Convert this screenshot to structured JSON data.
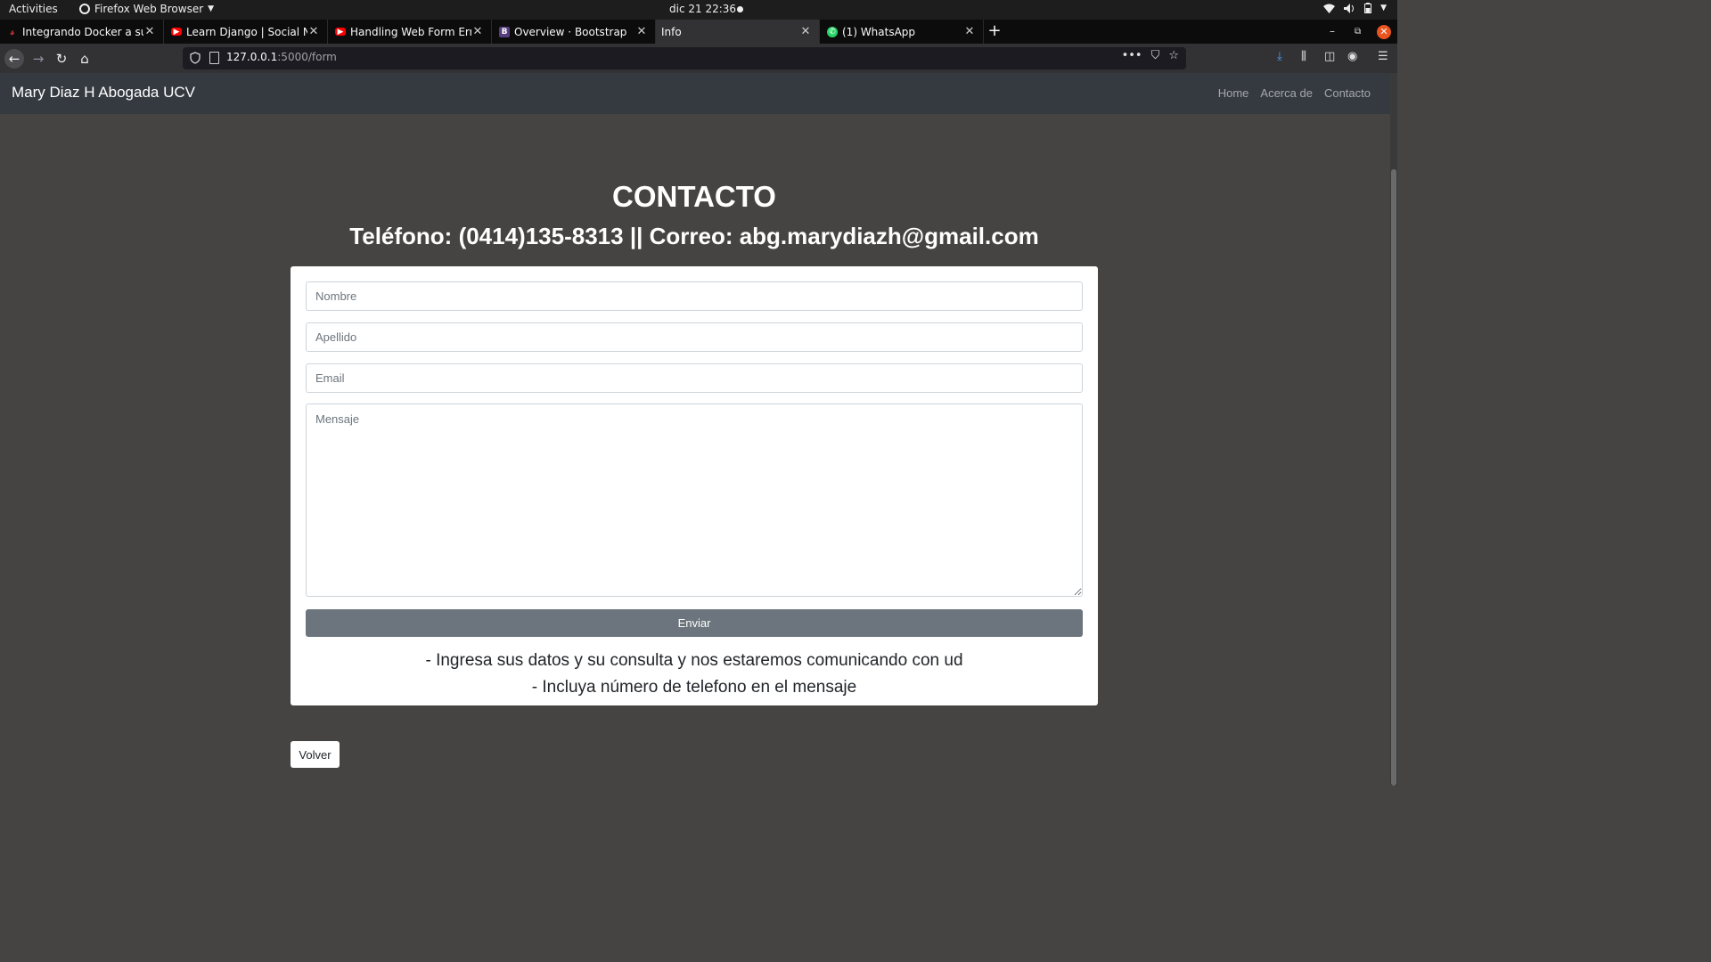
{
  "os_bar": {
    "activities": "Activities",
    "app_name": "Firefox Web Browser",
    "clock": "dic 21  22:36"
  },
  "browser": {
    "tabs": [
      {
        "title": "Integrando Docker a su",
        "favicon": "red-logo-icon",
        "color": "#d7333a",
        "active": false
      },
      {
        "title": "Learn Django | Social Ne",
        "favicon": "youtube-icon",
        "color": "#ff0000",
        "active": false
      },
      {
        "title": "Handling Web Form Erro",
        "favicon": "youtube-icon",
        "color": "#ff0000",
        "active": false
      },
      {
        "title": "Overview · Bootstrap",
        "favicon": "bootstrap-icon",
        "color": "#563d7c",
        "active": false
      },
      {
        "title": "Info",
        "favicon": "",
        "color": "",
        "active": true
      },
      {
        "title": "(1) WhatsApp",
        "favicon": "whatsapp-icon",
        "color": "#25d366",
        "active": false
      }
    ],
    "url_host": "127.0.0.1",
    "url_rest": ":5000/form"
  },
  "site": {
    "brand": "Mary Diaz H Abogada UCV",
    "nav": [
      "Home",
      "Acerca de",
      "Contacto"
    ],
    "heading": "CONTACTO",
    "subheading": "Teléfono: (0414)135-8313 || Correo: abg.marydiazh@gmail.com",
    "form": {
      "nombre_placeholder": "Nombre",
      "apellido_placeholder": "Apellido",
      "email_placeholder": "Email",
      "mensaje_placeholder": "Mensaje",
      "submit_label": "Enviar"
    },
    "notes": [
      "- Ingresa sus datos y su consulta y nos estaremos comunicando con ud",
      "- Incluya número de telefono en el mensaje"
    ],
    "back_label": "Volver"
  },
  "colors": {
    "page_bg": "#464442",
    "navbar_bg": "#343a40",
    "submit_bg": "#6c757d"
  }
}
